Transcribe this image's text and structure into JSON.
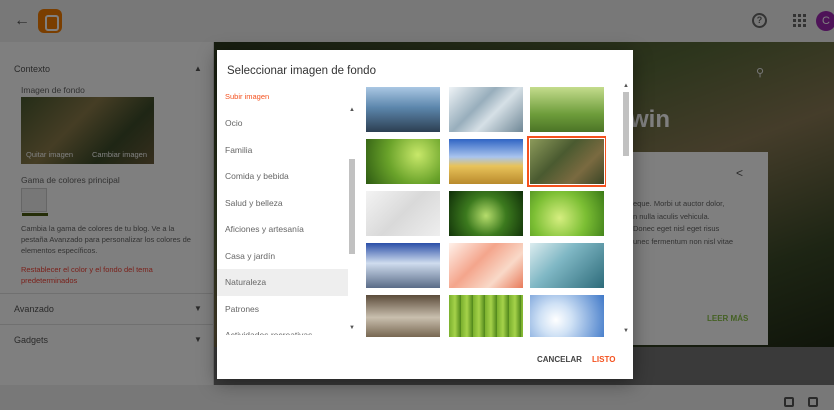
{
  "topbar": {
    "avatar_letter": "C"
  },
  "left_panel": {
    "section_context": "Contexto",
    "bg_image_label": "Imagen de fondo",
    "remove_image": "Quitar imagen",
    "change_image": "Cambiar imagen",
    "color_label": "Gama de colores principal",
    "help_text": "Cambia la gama de colores de tu blog. Ve a la pestaña Avanzado para personalizar los colores de elementos específicos.",
    "reset_link": "Restablecer el color y el fondo del tema predeterminados",
    "section_advanced": "Avanzado",
    "section_gadgets": "Gadgets"
  },
  "preview": {
    "title_fragment": "win",
    "body_lines": [
      "eque. Morbi ut auctor dolor,",
      "n nulla iaculis vehicula.",
      "Donec eget nisl eget risus",
      "unec fermentum non nisl vitae"
    ],
    "read_more": "LEER MÁS"
  },
  "dialog": {
    "title": "Seleccionar imagen de fondo",
    "upload": "Subir imagen",
    "categories": [
      "Ocio",
      "Familia",
      "Comida y bebida",
      "Salud y belleza",
      "Aficiones y artesanía",
      "Casa y jardín",
      "Naturaleza",
      "Patrones",
      "Actividades recreativas"
    ],
    "selected_category": "Naturaleza",
    "cancel": "CANCELAR",
    "ok": "LISTO"
  }
}
